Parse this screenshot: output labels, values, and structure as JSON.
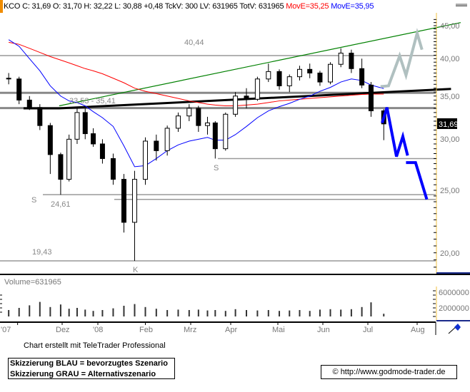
{
  "header": {
    "quote": "KCO C: 31,69 O: 31,70 H: 32,22 L: 30,88 +0,48 TckV: 300 LV: 631965 TotV: 631965",
    "ma_red": "MovE=35,25",
    "ma_blue": "MovE=35,95"
  },
  "colors": {
    "ma_red": "#ff0000",
    "ma_blue": "#0000ff",
    "trend_green": "#008000",
    "scenario_blue": "#0000ff",
    "scenario_gray": "#b0c0c0",
    "axis_border": "#f0c040"
  },
  "chart_data": {
    "type": "candlestick",
    "y_scale": "log",
    "ylim": [
      18.5,
      46.5
    ],
    "price_ticks": [
      "45,00",
      "40,00",
      "35,00",
      "30,00",
      "25,00",
      "20,00"
    ],
    "price_tick_values": [
      45,
      40,
      35,
      30,
      25,
      20
    ],
    "last_price_label": "31,69",
    "x_tick_labels": [
      "'07",
      "Dez",
      "'08",
      "Feb",
      "Mrz",
      "Apr",
      "Mai",
      "Jun",
      "Jul",
      "Aug"
    ],
    "x_tick_dates": [
      "2007-11-01",
      "2007-12-01",
      "2008-01-01",
      "2008-02-01",
      "2008-03-01",
      "2008-04-01",
      "2008-05-01",
      "2008-06-01",
      "2008-07-01",
      "2008-08-01"
    ],
    "candles": [
      {
        "date": "2007-10-26",
        "o": 37.3,
        "h": 38.0,
        "l": 36.5,
        "c": 37.2
      },
      {
        "date": "2007-11-02",
        "o": 37.2,
        "h": 37.5,
        "l": 34.0,
        "c": 34.5
      },
      {
        "date": "2007-11-09",
        "o": 34.5,
        "h": 35.0,
        "l": 33.3,
        "c": 33.6
      },
      {
        "date": "2007-11-16",
        "o": 33.6,
        "h": 34.0,
        "l": 31.0,
        "c": 31.5
      },
      {
        "date": "2007-11-23",
        "o": 31.5,
        "h": 31.8,
        "l": 26.5,
        "c": 28.4
      },
      {
        "date": "2007-11-30",
        "o": 28.4,
        "h": 28.6,
        "l": 24.61,
        "c": 26.0
      },
      {
        "date": "2007-12-07",
        "o": 26.0,
        "h": 30.5,
        "l": 25.8,
        "c": 30.0
      },
      {
        "date": "2007-12-14",
        "o": 30.0,
        "h": 33.6,
        "l": 29.5,
        "c": 33.0
      },
      {
        "date": "2007-12-21",
        "o": 33.0,
        "h": 33.5,
        "l": 30.0,
        "c": 30.6
      },
      {
        "date": "2007-12-28",
        "o": 30.6,
        "h": 31.2,
        "l": 29.2,
        "c": 29.5
      },
      {
        "date": "2008-01-04",
        "o": 29.5,
        "h": 30.0,
        "l": 27.5,
        "c": 28.0
      },
      {
        "date": "2008-01-11",
        "o": 28.0,
        "h": 28.5,
        "l": 25.5,
        "c": 26.0
      },
      {
        "date": "2008-01-18",
        "o": 26.0,
        "h": 26.5,
        "l": 21.5,
        "c": 22.3
      },
      {
        "date": "2008-01-25",
        "o": 22.3,
        "h": 26.8,
        "l": 19.43,
        "c": 26.0
      },
      {
        "date": "2008-02-01",
        "o": 26.0,
        "h": 30.2,
        "l": 25.5,
        "c": 29.8
      },
      {
        "date": "2008-02-08",
        "o": 29.8,
        "h": 30.5,
        "l": 27.8,
        "c": 28.8
      },
      {
        "date": "2008-02-15",
        "o": 28.8,
        "h": 31.5,
        "l": 28.3,
        "c": 31.2
      },
      {
        "date": "2008-02-22",
        "o": 31.2,
        "h": 33.0,
        "l": 30.8,
        "c": 32.6
      },
      {
        "date": "2008-02-29",
        "o": 32.6,
        "h": 34.0,
        "l": 32.0,
        "c": 33.5
      },
      {
        "date": "2008-03-07",
        "o": 33.5,
        "h": 33.8,
        "l": 30.8,
        "c": 31.5
      },
      {
        "date": "2008-03-14",
        "o": 31.5,
        "h": 32.5,
        "l": 30.5,
        "c": 31.8
      },
      {
        "date": "2008-03-20",
        "o": 31.8,
        "h": 32.0,
        "l": 28.0,
        "c": 29.0
      },
      {
        "date": "2008-03-28",
        "o": 29.0,
        "h": 33.0,
        "l": 28.8,
        "c": 32.8
      },
      {
        "date": "2008-04-04",
        "o": 32.8,
        "h": 35.5,
        "l": 32.5,
        "c": 35.0
      },
      {
        "date": "2008-04-11",
        "o": 35.0,
        "h": 36.0,
        "l": 33.5,
        "c": 34.6
      },
      {
        "date": "2008-04-18",
        "o": 34.6,
        "h": 37.5,
        "l": 34.4,
        "c": 37.2
      },
      {
        "date": "2008-04-25",
        "o": 37.2,
        "h": 39.3,
        "l": 36.8,
        "c": 38.2
      },
      {
        "date": "2008-05-02",
        "o": 38.2,
        "h": 38.5,
        "l": 35.8,
        "c": 36.3
      },
      {
        "date": "2008-05-09",
        "o": 36.3,
        "h": 37.8,
        "l": 35.5,
        "c": 37.5
      },
      {
        "date": "2008-05-16",
        "o": 37.5,
        "h": 39.0,
        "l": 37.0,
        "c": 38.5
      },
      {
        "date": "2008-05-23",
        "o": 38.5,
        "h": 39.3,
        "l": 37.3,
        "c": 38.0
      },
      {
        "date": "2008-05-30",
        "o": 38.0,
        "h": 38.3,
        "l": 36.3,
        "c": 36.8
      },
      {
        "date": "2008-06-06",
        "o": 36.8,
        "h": 39.5,
        "l": 36.5,
        "c": 39.2
      },
      {
        "date": "2008-06-13",
        "o": 39.2,
        "h": 41.5,
        "l": 38.8,
        "c": 40.8
      },
      {
        "date": "2008-06-20",
        "o": 40.8,
        "h": 41.3,
        "l": 38.0,
        "c": 38.6
      },
      {
        "date": "2008-06-27",
        "o": 38.6,
        "h": 40.0,
        "l": 36.0,
        "c": 36.4
      },
      {
        "date": "2008-07-03",
        "o": 36.4,
        "h": 36.8,
        "l": 32.5,
        "c": 33.2
      },
      {
        "date": "2008-07-11",
        "o": 33.2,
        "h": 33.4,
        "l": 29.9,
        "c": 31.69
      }
    ],
    "moving_averages": [
      {
        "label": "MovE=35,25",
        "color": "#ff0000",
        "values": [
          42.4,
          42.1,
          41.5,
          40.9,
          40.3,
          39.8,
          39.4,
          39.0,
          38.6,
          38.3,
          37.9,
          37.3,
          36.7,
          36.0,
          35.6,
          35.3,
          35.0,
          34.7,
          34.4,
          34.2,
          34.0,
          33.9,
          33.8,
          33.8,
          33.9,
          34.0,
          34.2,
          34.4,
          34.5,
          34.6,
          34.7,
          34.8,
          34.9,
          35.0,
          35.1,
          35.2,
          35.25,
          35.25
        ]
      },
      {
        "label": "MovE=35,95",
        "color": "#0000ff",
        "values": [
          42.8,
          41.8,
          40.0,
          38.3,
          36.3,
          35.0,
          34.4,
          34.2,
          33.8,
          33.1,
          32.4,
          31.4,
          29.3,
          27.2,
          27.3,
          28.0,
          28.8,
          29.4,
          29.8,
          30.0,
          30.2,
          29.9,
          29.9,
          30.5,
          31.4,
          32.4,
          33.2,
          33.7,
          34.1,
          34.6,
          35.0,
          35.6,
          36.1,
          36.8,
          37.2,
          37.0,
          36.4,
          35.95
        ]
      }
    ],
    "horizontal_levels": [
      {
        "value": 40.44,
        "label": "40,44"
      },
      {
        "value": 35.41,
        "label": "35,41"
      },
      {
        "value": 33.53,
        "label": "33,53"
      },
      {
        "value": 28.0,
        "label": ""
      },
      {
        "value": 24.61,
        "label": "24,61"
      },
      {
        "value": 24.2,
        "label": ""
      },
      {
        "value": 19.43,
        "label": "19,43"
      }
    ],
    "level_pair_label": "33,53 - 35,41",
    "trendlines": [
      {
        "name": "green-uptrend",
        "color": "#008000",
        "points": [
          [
            "2007-11-29",
            33.8
          ],
          [
            "2008-08-28",
            45.5
          ]
        ]
      },
      {
        "name": "black-neckline",
        "color": "#000000",
        "points": [
          [
            "2007-11-05",
            33.5
          ],
          [
            "2007-11-29",
            33.5
          ],
          [
            "2008-08-22",
            35.9
          ]
        ]
      }
    ],
    "scenarios": [
      {
        "name": "Skizzierung BLAU",
        "color": "#0000ff",
        "points": [
          [
            "2008-07-10",
            31.8
          ],
          [
            "2008-07-13",
            33.6
          ],
          [
            "2008-07-19",
            28.2
          ],
          [
            "2008-07-23",
            30.3
          ],
          [
            "2008-07-26",
            28.3
          ]
        ]
      },
      {
        "name": "Skizzierung BLAU 2",
        "color": "#0000ff",
        "points": [
          [
            "2008-07-25",
            27.6
          ],
          [
            "2008-07-31",
            27.6
          ],
          [
            "2008-08-07",
            24.2
          ]
        ]
      },
      {
        "name": "Skizzierung GRAU",
        "color": "#b0c0c0",
        "points": [
          [
            "2008-07-09",
            36.2
          ],
          [
            "2008-07-14",
            36.3
          ],
          [
            "2008-07-21",
            40.4
          ],
          [
            "2008-07-25",
            37.7
          ],
          [
            "2008-08-01",
            43.8
          ],
          [
            "2008-08-04",
            41.3
          ]
        ]
      }
    ],
    "pattern_labels": [
      {
        "text": "S",
        "date": "2007-11-22",
        "price": 23.4
      },
      {
        "text": "K",
        "date": "2008-01-27",
        "price": 18.8
      },
      {
        "text": "S",
        "date": "2008-03-19",
        "price": 26.9
      }
    ],
    "volume": {
      "label": "Volume=631965",
      "ticks": [
        "6000000",
        "2000000"
      ],
      "tick_values": [
        6000000,
        2000000
      ],
      "values": [
        1500000,
        2000000,
        2600000,
        3400000,
        2200000,
        2800000,
        1800000,
        2000000,
        1600000,
        1300000,
        1500000,
        1900000,
        2500000,
        2900000,
        2200000,
        1800000,
        1500000,
        1600000,
        1500000,
        1600000,
        1400000,
        1500000,
        1300000,
        1700000,
        1500000,
        1400000,
        1500000,
        1300000,
        1400000,
        1500000,
        1300000,
        1600000,
        1700000,
        1600000,
        1700000,
        2200000,
        3300000,
        631965
      ]
    }
  },
  "footer": {
    "credit": "Chart erstellt mit TeleTrader Professional",
    "legend_blue": "Skizzierung BLAU = bevorzugtes Szenario",
    "legend_gray": "Skizzierung GRAU = Alternativszenario",
    "copyright": "© http://www.godmode-trader.de"
  }
}
